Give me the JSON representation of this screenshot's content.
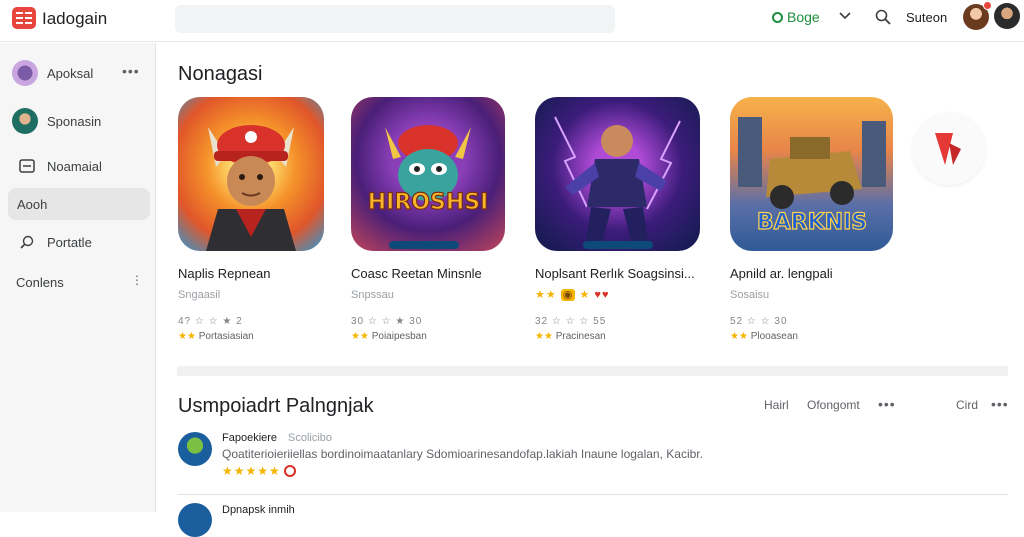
{
  "app": {
    "title": "Iadogain"
  },
  "topbar": {
    "account_label": "Boge",
    "signin_label": "Suteon"
  },
  "sidebar": {
    "items": [
      {
        "label": "Apoksal"
      },
      {
        "label": "Sponasin"
      },
      {
        "label": "Noamaial"
      },
      {
        "label": "Aooh"
      },
      {
        "label": "Portatle"
      },
      {
        "label": "Conlens"
      }
    ]
  },
  "section1": {
    "title": "Nonagasi",
    "apps": [
      {
        "name": "Naplis Repnean",
        "developer": "Sngaasil",
        "rating": "4? ☆ ☆ ★ 2",
        "meta": "Portasiasian",
        "art_text": ""
      },
      {
        "name": "Coasc Reetan Minsnle",
        "developer": "Snpssau",
        "rating": "30 ☆ ☆ ★ 30",
        "meta": "Poiaipesban",
        "art_text": "HIROSHSI"
      },
      {
        "name": "Noplsant Rerlık Soagsinsi...",
        "developer": "",
        "rating": "32 ☆ ☆ ☆ 55",
        "meta": "Pracinesan",
        "art_text": ""
      },
      {
        "name": "Apnild ar. lengpali",
        "developer": "Sosaisu",
        "rating": "52 ☆ ☆ 30",
        "meta": "Plooasean",
        "art_text": "BARKNIS"
      }
    ]
  },
  "section2": {
    "title": "Usmpoiadrt Palngnjak",
    "filters": [
      "Hairl",
      "Ofongomt",
      "Cird"
    ],
    "reviews": [
      {
        "name": "Fapoekiere",
        "date": "Scolicibo",
        "text": "Qoatiterioieriiellas bordinoimaatanlary Sdomioarinesandofap.lakiah Inaune logalan, Kacibr.",
        "stars": "★★★★★"
      },
      {
        "name": "Dpnapsk inmih",
        "date": ""
      }
    ]
  },
  "colors": {
    "brand": "#e8453c",
    "accent_green": "#1e8e3e",
    "star": "#f4b400"
  }
}
